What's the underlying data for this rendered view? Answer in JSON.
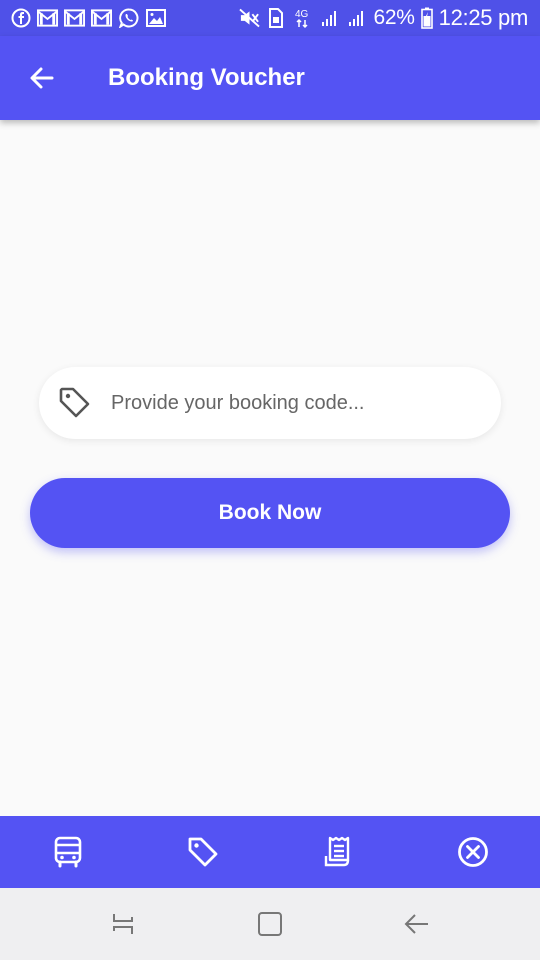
{
  "status_bar": {
    "battery": "62%",
    "time": "12:25 pm",
    "network": "4G",
    "left_icons": [
      "facebook-icon",
      "gmail-icon",
      "gmail-icon",
      "gmail-icon",
      "whatsapp-icon",
      "gallery-icon"
    ],
    "right_icons": [
      "mute-icon",
      "sim-icon",
      "network-4g-icon",
      "signal-icon",
      "signal-icon",
      "battery-icon"
    ]
  },
  "app_bar": {
    "title": "Booking Voucher",
    "back_icon": "arrow-left-icon"
  },
  "form": {
    "code_placeholder": "Provide your booking code...",
    "code_value": "",
    "field_icon": "tag-icon",
    "book_button_label": "Book Now"
  },
  "bottom_nav": {
    "items": [
      {
        "icon": "bus-icon"
      },
      {
        "icon": "tag-icon"
      },
      {
        "icon": "receipt-icon"
      },
      {
        "icon": "close-circle-icon"
      }
    ]
  },
  "system_nav": {
    "items": [
      "recent-apps-icon",
      "home-icon",
      "back-icon"
    ]
  },
  "colors": {
    "primary": "#5453f3",
    "status_bar": "#4f51e8",
    "background": "#fafafa",
    "system_nav": "#efeff1"
  }
}
